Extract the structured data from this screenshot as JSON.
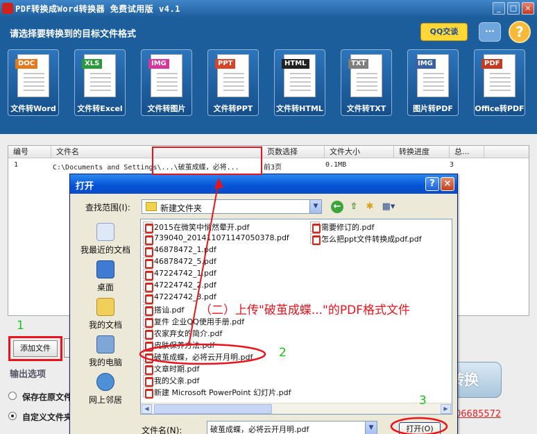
{
  "app": {
    "title": "PDF转换成Word转换器 免费试用版 v4.1",
    "prompt": "请选择要转换到的目标文件格式",
    "qq_label": "QQ交谈",
    "help_glyph": "?"
  },
  "formats": [
    {
      "tag": "DOC",
      "label": "文件转Word",
      "color": "#e07b22"
    },
    {
      "tag": "XLS",
      "label": "文件转Excel",
      "color": "#2c9a3c"
    },
    {
      "tag": "IMG",
      "label": "文件转图片",
      "color": "#d6359b"
    },
    {
      "tag": "PPT",
      "label": "文件转PPT",
      "color": "#d6452a"
    },
    {
      "tag": "HTML",
      "label": "文件转HTML",
      "color": "#222222"
    },
    {
      "tag": "TXT",
      "label": "文件转TXT",
      "color": "#7e7e7e"
    },
    {
      "tag": "IMG",
      "label": "图片转PDF",
      "color": "#3b5fa3"
    },
    {
      "tag": "PDF",
      "label": "Office转PDF",
      "color": "#c23b22"
    }
  ],
  "table": {
    "headers": [
      "编号",
      "文件名",
      "页数选择",
      "文件大小",
      "转换进度",
      "总..."
    ],
    "rows": [
      {
        "num": "1",
        "file": "C:\\Documents and Settings\\...\\破茧成蝶，必将...",
        "pages": "前3页",
        "size": "0.1MB",
        "progress": "",
        "total": "3"
      }
    ]
  },
  "controls": {
    "add_file": "添加文件",
    "output_options": "输出选项",
    "opt_save_original": "保存在原文件",
    "opt_custom": "自定义文件夹",
    "convert": "转换",
    "phone": "06685572"
  },
  "dialog": {
    "title": "打开",
    "look_in_label": "查找范围(I):",
    "look_in_value": "新建文件夹",
    "places": [
      "我最近的文档",
      "桌面",
      "我的文档",
      "我的电脑",
      "网上邻居"
    ],
    "files_col1": [
      "2015在微笑中悄然晕开.pdf",
      "739040_201411071147050378.pdf",
      "46878472_1.pdf",
      "46878472_5.pdf",
      "47224742_1.pdf",
      "47224742_2.pdf",
      "47224742_3.pdf",
      "搭讪.pdf",
      "复件 企业QQ使用手册.pdf",
      "农家弃女的简介.pdf",
      "皮肤保养方法.pdf",
      "破茧成蝶，必将云开月明.pdf",
      "文章时期.pdf",
      "我的父亲.pdf",
      "新建 Microsoft PowerPoint 幻灯片.pdf"
    ],
    "files_col2": [
      "需要修订的.pdf",
      "怎么把ppt文件转换成pdf.pdf"
    ],
    "filename_label": "文件名(N):",
    "filename_value": "破茧成蝶，必将云开月明.pdf",
    "open_label": "打开(O)"
  },
  "annotations": {
    "step1": "1",
    "step2": "2",
    "step3": "3",
    "text": "（二）上传\"破茧成蝶...\"的PDF格式文件",
    "color": "#e8131b",
    "step_color": "#18c21b"
  }
}
